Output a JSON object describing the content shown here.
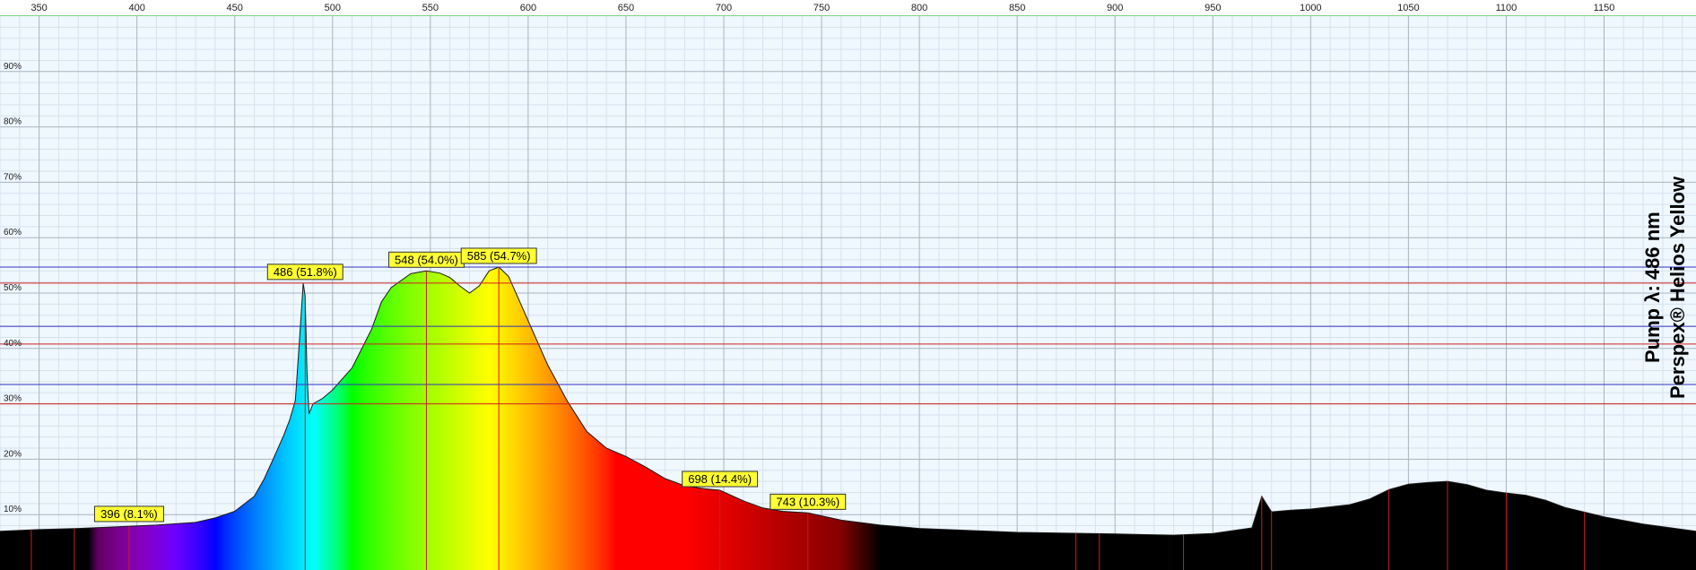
{
  "chart_data": {
    "type": "area",
    "xlim": [
      330,
      1197
    ],
    "ylim": [
      0,
      100
    ],
    "x_ticks": [
      350,
      400,
      450,
      500,
      550,
      600,
      650,
      700,
      750,
      800,
      850,
      900,
      950,
      1000,
      1050,
      1100,
      1150
    ],
    "y_ticks": [
      10,
      20,
      30,
      40,
      50,
      60,
      70,
      80,
      90
    ],
    "y_tick_format": "%",
    "grid": true,
    "side_text": [
      "Pump λ: 486 nm",
      "Perspex® Helios Yellow"
    ],
    "blue_hlines": [
      54.7,
      44.0,
      33.5
    ],
    "red_hlines": [
      51.8,
      40.8,
      30.0
    ],
    "annotations": [
      {
        "label": "396 (8.1%)",
        "x": 396,
        "y": 8.1
      },
      {
        "label": "486 (51.8%)",
        "x": 486,
        "y": 51.8
      },
      {
        "label": "548 (54.0%)",
        "x": 548,
        "y": 54.0
      },
      {
        "label": "585 (54.7%)",
        "x": 585,
        "y": 54.7
      },
      {
        "label": "698 (14.4%)",
        "x": 698,
        "y": 14.4
      },
      {
        "label": "743 (10.3%)",
        "x": 743,
        "y": 10.3
      }
    ],
    "peak_markers": [
      346,
      368,
      396,
      486,
      548,
      585,
      698,
      743,
      880,
      892,
      935,
      975,
      980,
      1040,
      1070,
      1100,
      1140
    ],
    "series": [
      {
        "values_x": [
          330,
          350,
          370,
          390,
          410,
          430,
          440,
          450,
          460,
          465,
          470,
          475,
          478,
          481,
          483,
          485,
          486,
          487,
          488,
          490,
          495,
          500,
          510,
          520,
          525,
          530,
          540,
          548,
          555,
          560,
          565,
          570,
          575,
          580,
          585,
          590,
          600,
          610,
          620,
          630,
          640,
          650,
          660,
          670,
          680,
          690,
          698,
          710,
          720,
          730,
          743,
          760,
          780,
          800,
          850,
          900,
          930,
          950,
          970,
          975,
          980,
          990,
          1000,
          1020,
          1030,
          1040,
          1050,
          1060,
          1070,
          1080,
          1090,
          1100,
          1110,
          1120,
          1130,
          1150,
          1170,
          1197
        ],
        "values_y": [
          7.0,
          7.3,
          7.5,
          7.8,
          8.1,
          8.6,
          9.4,
          10.6,
          13.3,
          16.4,
          20.3,
          24.3,
          27.0,
          30.6,
          41.0,
          51.8,
          49.5,
          35.0,
          28.2,
          30.0,
          31.0,
          32.5,
          36.5,
          43.5,
          48.4,
          51.0,
          53.5,
          54.0,
          53.6,
          52.8,
          51.3,
          50.0,
          51.3,
          54.0,
          54.7,
          53.0,
          45.0,
          37.0,
          30.5,
          25.0,
          22.0,
          20.5,
          18.6,
          16.5,
          15.2,
          14.7,
          14.4,
          12.5,
          11.2,
          10.6,
          10.3,
          9.0,
          8.1,
          7.5,
          6.8,
          6.5,
          6.3,
          6.6,
          7.6,
          13.3,
          10.5,
          10.8,
          11.0,
          11.8,
          12.8,
          14.5,
          15.5,
          15.8,
          16.0,
          15.4,
          14.4,
          13.9,
          13.5,
          12.6,
          11.3,
          9.6,
          8.3,
          7.0
        ]
      }
    ]
  }
}
